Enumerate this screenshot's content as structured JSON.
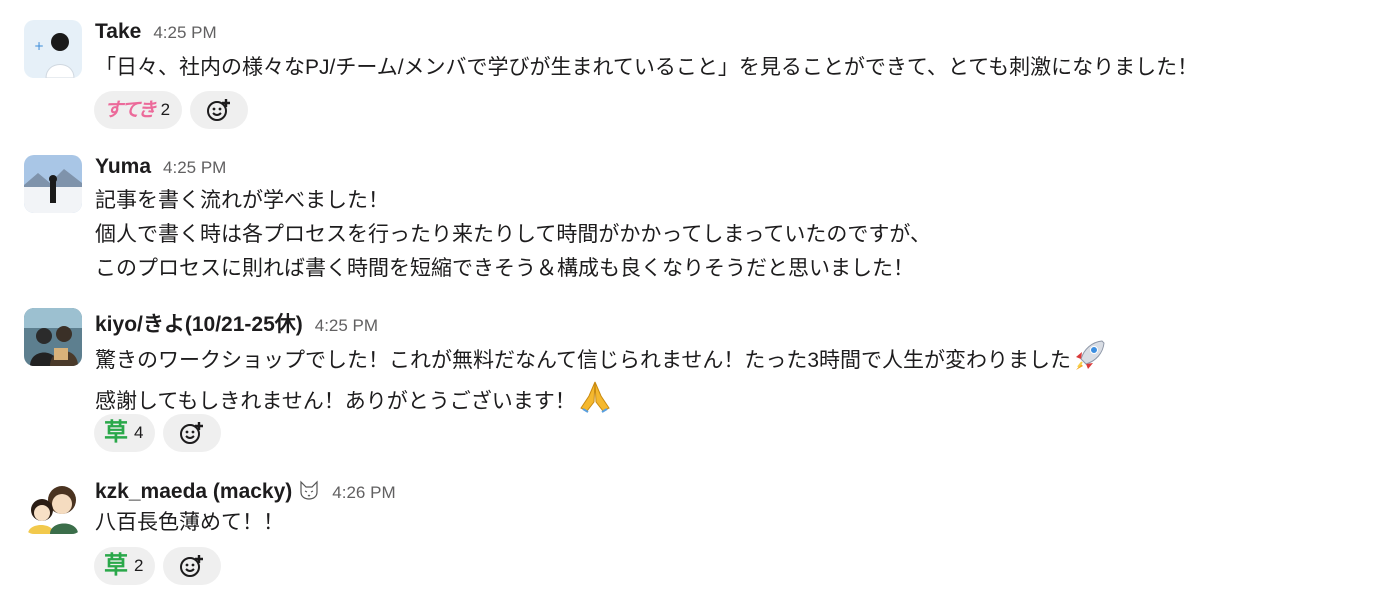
{
  "messages": [
    {
      "author": "Take",
      "time": "4:25 PM",
      "lines": [
        "「日々、社内の様々なPJ/チーム/メンバで学びが生まれていること」を見ることができて、とても刺激になりました！"
      ],
      "reactions": [
        {
          "emoji": "すてき",
          "count": "2"
        }
      ]
    },
    {
      "author": "Yuma",
      "time": "4:25 PM",
      "lines": [
        "記事を書く流れが学べました！",
        "個人で書く時は各プロセスを行ったり来たりして時間がかかってしまっていたのですが、",
        "このプロセスに則れば書く時間を短縮できそう＆構成も良くなりそうだと思いました！"
      ],
      "reactions": []
    },
    {
      "author": "kiyo/きよ(10/21-25休)",
      "time": "4:25 PM",
      "lines": [
        "驚きのワークショップでした！これが無料だなんて信じられません！たった3時間で人生が変わりました",
        "感謝してもしきれません！ありがとうございます！"
      ],
      "inline_emojis": [
        "rocket-emoji",
        "folded-hands-emoji"
      ],
      "reactions": [
        {
          "emoji": "草",
          "count": "4"
        }
      ]
    },
    {
      "author": "kzk_maeda (macky)",
      "time": "4:26 PM",
      "status_icon": "cat-face-badge-icon",
      "lines": [
        "八百長色薄めて！！"
      ],
      "reactions": [
        {
          "emoji": "草",
          "count": "2"
        }
      ]
    }
  ],
  "icons": {
    "add_reaction": "add-reaction-icon",
    "badge": "cat-face-badge-icon"
  },
  "colors": {
    "reaction_bg": "#efefef",
    "timestamp": "#616061",
    "kusa_green": "#2aa84a",
    "suki_pink": "#ec6a9a"
  }
}
